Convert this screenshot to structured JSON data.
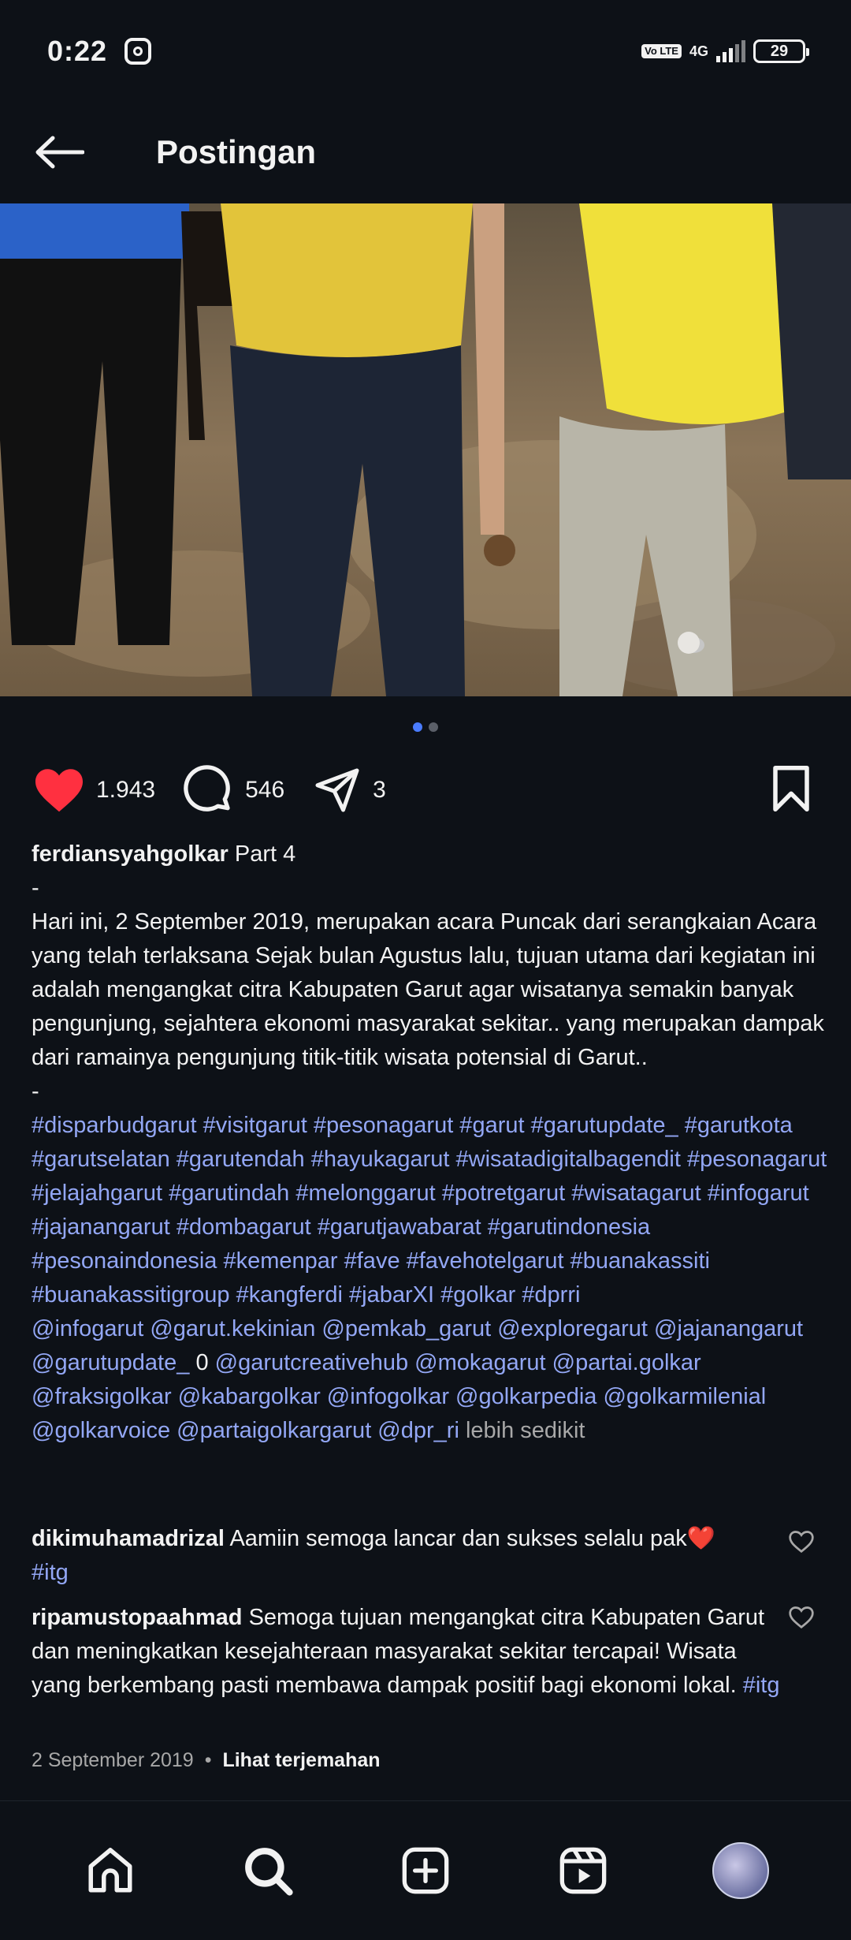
{
  "status": {
    "time": "0:22",
    "volte": "Vo LTE",
    "network": "4G",
    "battery": "29"
  },
  "header": {
    "title": "Postingan"
  },
  "actions": {
    "likes": "1.943",
    "comments": "546",
    "shares": "3"
  },
  "caption": {
    "username": "ferdiansyahgolkar",
    "title": "Part 4",
    "dash1": "-",
    "body": "Hari ini, 2 September 2019, merupakan acara Puncak dari serangkaian Acara yang telah terlaksana Sejak bulan Agustus lalu, tujuan utama dari kegiatan ini adalah mengangkat citra Kabupaten Garut agar wisatanya semakin banyak pengunjung, sejahtera ekonomi masyarakat sekitar.. yang merupakan dampak dari ramainya pengunjung titik-titik wisata potensial di Garut..",
    "dash2": "-",
    "hashtags": "#disparbudgarut #visitgarut #pesonagarut #garut #garutupdate_ #garutkota #garutselatan #garutendah #hayukagarut #wisatadigitalbagendit #pesonagarut #jelajahgarut #garutindah #melonggarut #potretgarut #wisatagarut #infogarut #jajanangarut #dombagarut #garutjawabarat #garutindonesia #pesonaindonesia #kemenpar #fave #favehotelgarut #buanakassiti #buanakassitigroup #kangferdi #jabarXI #golkar #dprri",
    "mentions_a": "@infogarut @garut.kekinian @pemkab_garut @exploregarut @jajanangarut @garutupdate_",
    "mentions_zero": "0",
    "mentions_b": "@garutcreativehub @mokagarut @partai.golkar @fraksigolkar @kabargolkar @infogolkar @golkarpedia @golkarmilenial @golkarvoice @partaigolkargarut @dpr_ri",
    "more": "lebih sedikit"
  },
  "comments": [
    {
      "username": "dikimuhamadrizal",
      "text": "Aamiin semoga lancar dan sukses selalu pak❤️",
      "tag": "#itg"
    },
    {
      "username": "ripamustopaahmad",
      "text": "Semoga tujuan mengangkat citra Kabupaten Garut dan meningkatkan kesejahteraan masyarakat sekitar tercapai! Wisata yang berkembang pasti membawa dampak positif bagi ekonomi lokal.",
      "tag": "#itg"
    }
  ],
  "meta": {
    "date": "2 September 2019",
    "separator": "•",
    "translate": "Lihat terjemahan"
  },
  "colors": {
    "background": "#0d1117",
    "like": "#ff3040",
    "link": "#93a7f5",
    "active_dot": "#4a7cff"
  }
}
